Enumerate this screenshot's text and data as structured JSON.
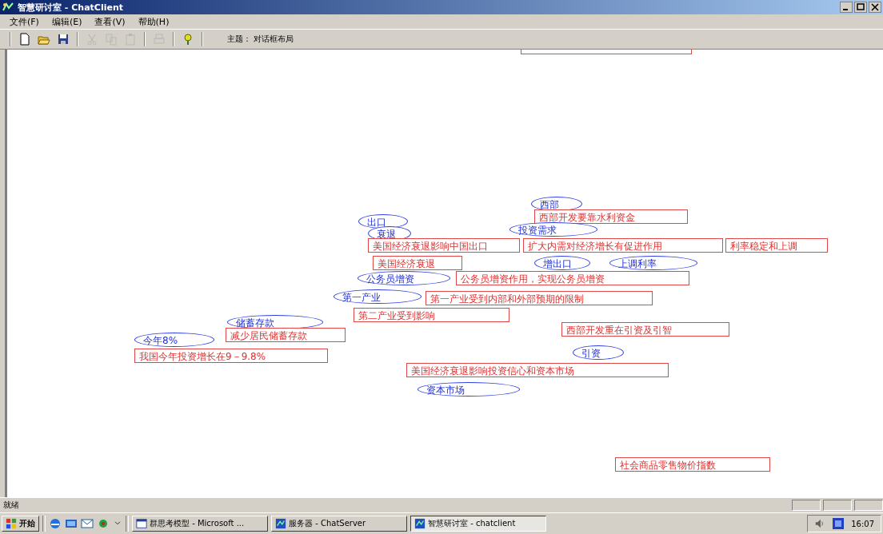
{
  "window": {
    "title": "智慧研讨室 - ChatClient"
  },
  "menu": [
    "文件(F)",
    "编辑(E)",
    "查看(V)",
    "帮助(H)"
  ],
  "toolbar": {
    "buttons": [
      {
        "kind": "new",
        "disabled": false
      },
      {
        "kind": "open",
        "disabled": false
      },
      {
        "kind": "save",
        "disabled": false
      },
      {
        "kind": "cut",
        "disabled": true
      },
      {
        "kind": "copy",
        "disabled": true
      },
      {
        "kind": "paste",
        "disabled": true
      },
      {
        "kind": "print",
        "disabled": true
      },
      {
        "kind": "help",
        "disabled": false
      }
    ],
    "topic": "主题： 对话框布局"
  },
  "diagram": {
    "nodes": [
      {
        "kind": "keyword",
        "text": "西部"
      },
      {
        "kind": "topic",
        "text": "西部开发要靠水利资金"
      },
      {
        "kind": "keyword",
        "text": "出口"
      },
      {
        "kind": "keyword",
        "text": "衰退"
      },
      {
        "kind": "topic",
        "text": "美国经济衰退影响中国出口"
      },
      {
        "kind": "keyword",
        "text": "投资需求"
      },
      {
        "kind": "topic",
        "text": "扩大内需对经济增长有促进作用"
      },
      {
        "kind": "topic",
        "text": "利率稳定和上调"
      },
      {
        "kind": "topic",
        "text": "美国经济衰退"
      },
      {
        "kind": "keyword",
        "text": "增出口"
      },
      {
        "kind": "keyword",
        "text": "上调利率"
      },
      {
        "kind": "keyword",
        "text": "公务员增资"
      },
      {
        "kind": "topic",
        "text": "公务员增资作用，实现公务员增资"
      },
      {
        "kind": "keyword",
        "text": "第一产业"
      },
      {
        "kind": "topic",
        "text": "第一产业受到内部和外部预期的限制"
      },
      {
        "kind": "topic",
        "text": "第二产业受到影响"
      },
      {
        "kind": "keyword",
        "text": "储蓄存款"
      },
      {
        "kind": "topic",
        "text": "减少居民储蓄存款"
      },
      {
        "kind": "keyword",
        "text": "今年8%"
      },
      {
        "kind": "topic",
        "text": "我国今年投资增长在9－9.8%"
      },
      {
        "kind": "topic",
        "text": "西部开发重在引资及引智"
      },
      {
        "kind": "keyword",
        "text": "引资"
      },
      {
        "kind": "topic",
        "text": "美国经济衰退影响投资信心和资本市场"
      },
      {
        "kind": "keyword",
        "text": "资本市场"
      },
      {
        "kind": "topic",
        "text": "社会商品零售物价指数"
      }
    ]
  },
  "status_bar": "就绪",
  "taskbar": {
    "start": "开始",
    "tasks": [
      {
        "label": "群思考模型 - Microsoft ...",
        "kind": "document",
        "selected": false
      },
      {
        "label": "服务器 - ChatServer",
        "kind": "app",
        "selected": false
      },
      {
        "label": "智慧研讨室 - chatclient",
        "kind": "app",
        "selected": true
      }
    ],
    "time": "16:07"
  }
}
